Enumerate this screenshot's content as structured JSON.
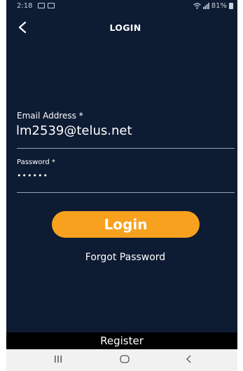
{
  "status_bar": {
    "time": "2:18",
    "signal_text": "81%",
    "icons": [
      "message-icon",
      "image-icon",
      "wifi-icon",
      "signal-icon",
      "battery-icon"
    ]
  },
  "header": {
    "title": "LOGIN",
    "back_icon": "chevron-left-icon"
  },
  "form": {
    "email_label": "Email Address *",
    "email_value": "lm2539@telus.net",
    "password_label": "Password *",
    "password_value": "••••••"
  },
  "actions": {
    "login_label": "Login",
    "forgot_label": "Forgot Password",
    "register_label": "Register"
  },
  "nav": {
    "icons": [
      "recent-apps-icon",
      "home-icon",
      "back-icon"
    ]
  },
  "colors": {
    "background": "#0d1b33",
    "accent": "#f7a11f",
    "text": "#ffffff",
    "divider": "#9aa3b3",
    "register_bar": "#000000",
    "nav_bar": "#f1f1f1"
  }
}
